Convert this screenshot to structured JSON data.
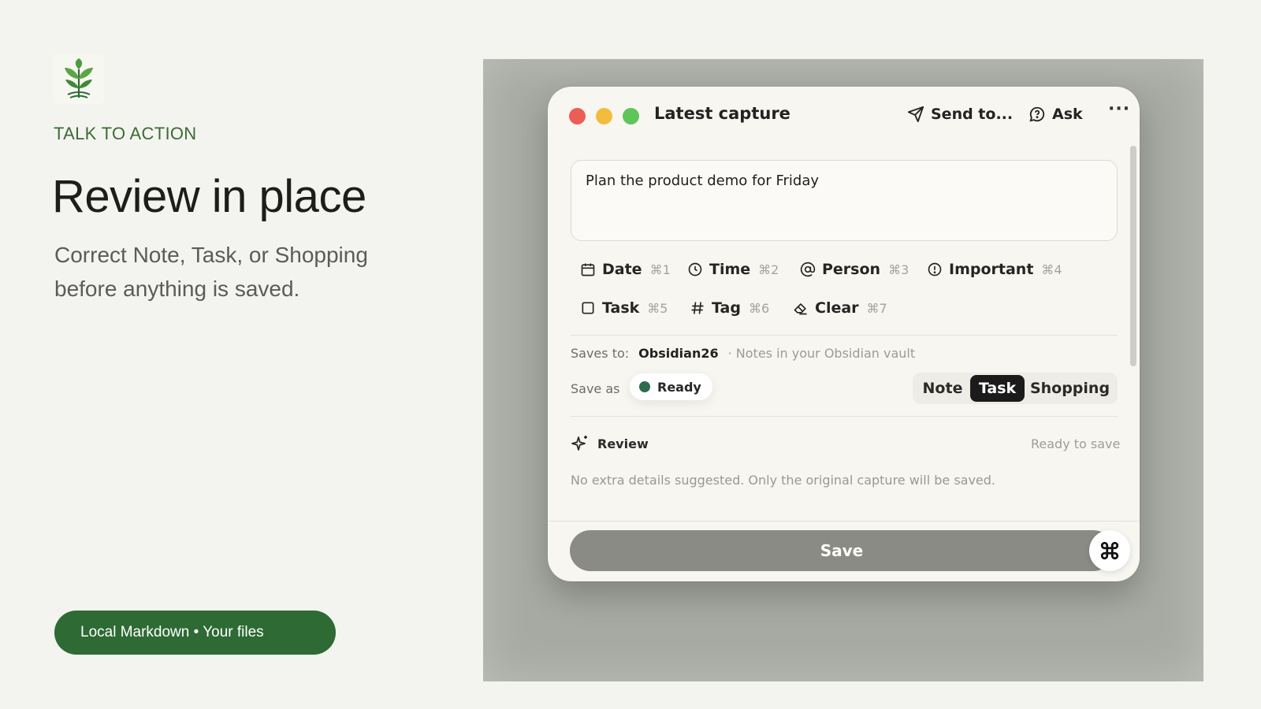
{
  "brand": {
    "logo_icon": "sprout-icon",
    "accent": "#2e6a34"
  },
  "hero": {
    "eyebrow": "TALK TO ACTION",
    "headline": "Review in place",
    "subhead": "Correct Note, Task, or Shopping before anything is saved.",
    "pill": "Local Markdown • Your files"
  },
  "window": {
    "title": "Latest capture",
    "send_label": "Send to...",
    "ask_label": "Ask",
    "more_label": "···",
    "capture_text": "Plan the product demo for Friday",
    "chips": [
      {
        "label": "Date",
        "shortcut": "⌘1",
        "icon": "calendar-icon"
      },
      {
        "label": "Time",
        "shortcut": "⌘2",
        "icon": "clock-icon"
      },
      {
        "label": "Person",
        "shortcut": "⌘3",
        "icon": "at-icon"
      },
      {
        "label": "Important",
        "shortcut": "⌘4",
        "icon": "alert-icon"
      },
      {
        "label": "Task",
        "shortcut": "⌘5",
        "icon": "checkbox-icon"
      },
      {
        "label": "Tag",
        "shortcut": "⌘6",
        "icon": "hash-icon"
      },
      {
        "label": "Clear",
        "shortcut": "⌘7",
        "icon": "eraser-icon"
      }
    ],
    "saves_to_label": "Saves to:",
    "vault_name": "Obsidian26",
    "vault_desc": "· Notes in your Obsidian vault",
    "save_as_label": "Save as",
    "ready_label": "Ready",
    "types": [
      "Note",
      "Task",
      "Shopping"
    ],
    "active_type": "Task",
    "review_label": "Review",
    "review_status": "Ready to save",
    "review_note": "No extra details suggested. Only the original capture will be saved.",
    "save_button": "Save"
  }
}
